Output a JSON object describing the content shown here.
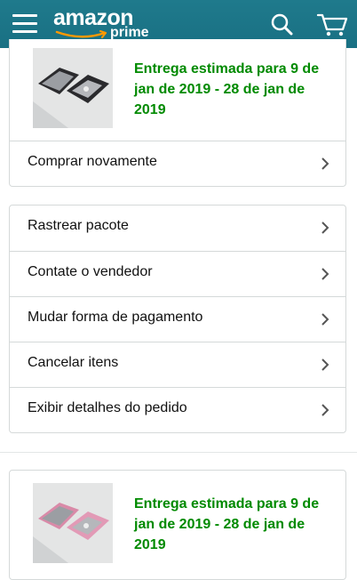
{
  "header": {
    "logo_text": "amazon",
    "logo_sub": "prime",
    "icons": [
      "menu-icon",
      "search-icon",
      "cart-icon"
    ]
  },
  "order1": {
    "delivery": "Entrega estimada para 9 de jan de 2019 - 28 de jan de 2019",
    "buy_again": "Comprar novamente"
  },
  "actions": [
    {
      "label": "Rastrear pacote"
    },
    {
      "label": "Contate o vendedor"
    },
    {
      "label": "Mudar forma de pagamento"
    },
    {
      "label": "Cancelar itens"
    },
    {
      "label": "Exibir detalhes do pedido"
    }
  ],
  "order2": {
    "delivery": "Entrega estimada para 9 de jan de 2019 - 28 de jan de 2019"
  },
  "colors": {
    "header_bg": "#1f7a8c",
    "delivery_text": "#008a00",
    "border": "#d5d9d9"
  }
}
